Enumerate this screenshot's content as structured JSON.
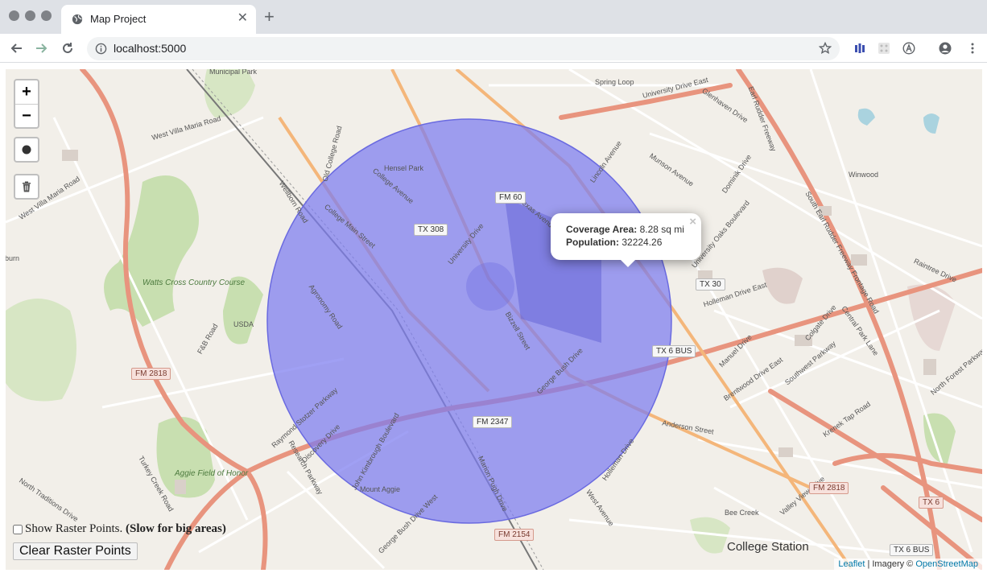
{
  "browser": {
    "tab_title": "Map Project",
    "tab_icon": "globe-icon",
    "new_tab_label": "+",
    "url": "localhost:5000"
  },
  "map": {
    "zoom_in_label": "+",
    "zoom_out_label": "−",
    "draw_circle_icon": "circle-icon",
    "delete_icon": "trash-icon",
    "coverage_circle_color": "#7b7bf0",
    "popup": {
      "area_label": "Coverage Area:",
      "area_value": "8.28 sq mi",
      "population_label": "Population:",
      "population_value": "32224.26"
    },
    "raster_checkbox_label": "Show Raster Points.",
    "raster_warning": "(Slow for big areas)",
    "raster_checked": false,
    "clear_button_label": "Clear Raster Points",
    "attribution": {
      "leaflet": "Leaflet",
      "separator": " | Imagery © ",
      "osm": "OpenStreetMap"
    },
    "city_label": "College Station",
    "labels": {
      "municipal_park": "Municipal Park",
      "spring_loop": "Spring Loop",
      "university_drive_east": "University Drive East",
      "earl_rudder_freeway": "Earl Rudder Freeway",
      "glenhaven_drive": "Glenhaven Drive",
      "west_villa_maria": "West Villa Maria Road",
      "hensel_park": "Hensel Park",
      "college_avenue": "College Avenue",
      "old_college_road": "Old College Road",
      "lincoln_avenue": "Lincoln Avenue",
      "munson_avenue": "Munson Avenue",
      "dominik_drive": "Dominik Drive",
      "winwood": "Winwood",
      "wellborn_road": "Wellborn Road",
      "college_main": "College Main Street",
      "texas_avenue": "Texas Avenue",
      "university_drive": "University Drive",
      "university_oaks": "University Oaks Boulevard",
      "frontage_road": "South Earl Rudder Freeway Frontage Road",
      "raintree": "Raintree Drive",
      "watts_cross": "Watts Cross Country Course",
      "usda": "USDA",
      "fb_road": "F&B Road",
      "agronomy": "Agronomy Road",
      "bizzell": "Bizzell Street",
      "george_bush": "George Bush Drive",
      "holleman_east": "Holleman Drive East",
      "colgate": "Colgate Drive",
      "central_park": "Central Park Lane",
      "manuel": "Manuel Drive",
      "southwest_pkwy": "Southwest Parkway",
      "brentwood": "Brentwood Drive East",
      "north_forest": "North Forest Parkway",
      "anderson": "Anderson Street",
      "krenek": "Krenek Tap Road",
      "raymond_stotzer": "Raymond Stotzer Parkway",
      "discovery": "Discovery Drive",
      "research_pkwy": "Research Parkway",
      "kimbrough": "John Kimbrough Boulevard",
      "turkey_creek": "Turkey Creek Road",
      "aggie_field": "Aggie Field of Honor",
      "north_traditions": "North Traditions Drive",
      "holleman_drive": "Holleman Drive",
      "west_avenue": "West Avenue",
      "marion_pugh": "Marion Pugh Drive",
      "valley_view": "Valley View Drive",
      "bee_creek": "Bee Creek",
      "george_bush_west": "George Bush Drive West",
      "mount_aggie": "Mount Aggie",
      "burn": "lburn"
    },
    "shields": {
      "fm60": "FM 60",
      "tx308": "TX 308",
      "tx30": "TX 30",
      "tx6bus": "TX 6 BUS",
      "fm2818_left": "FM 2818",
      "fm2347": "FM 2347",
      "fm2154": "FM 2154",
      "fm2818_right": "FM 2818",
      "tx6": "TX 6",
      "tx6bus_bottom": "TX 6 BUS"
    }
  }
}
